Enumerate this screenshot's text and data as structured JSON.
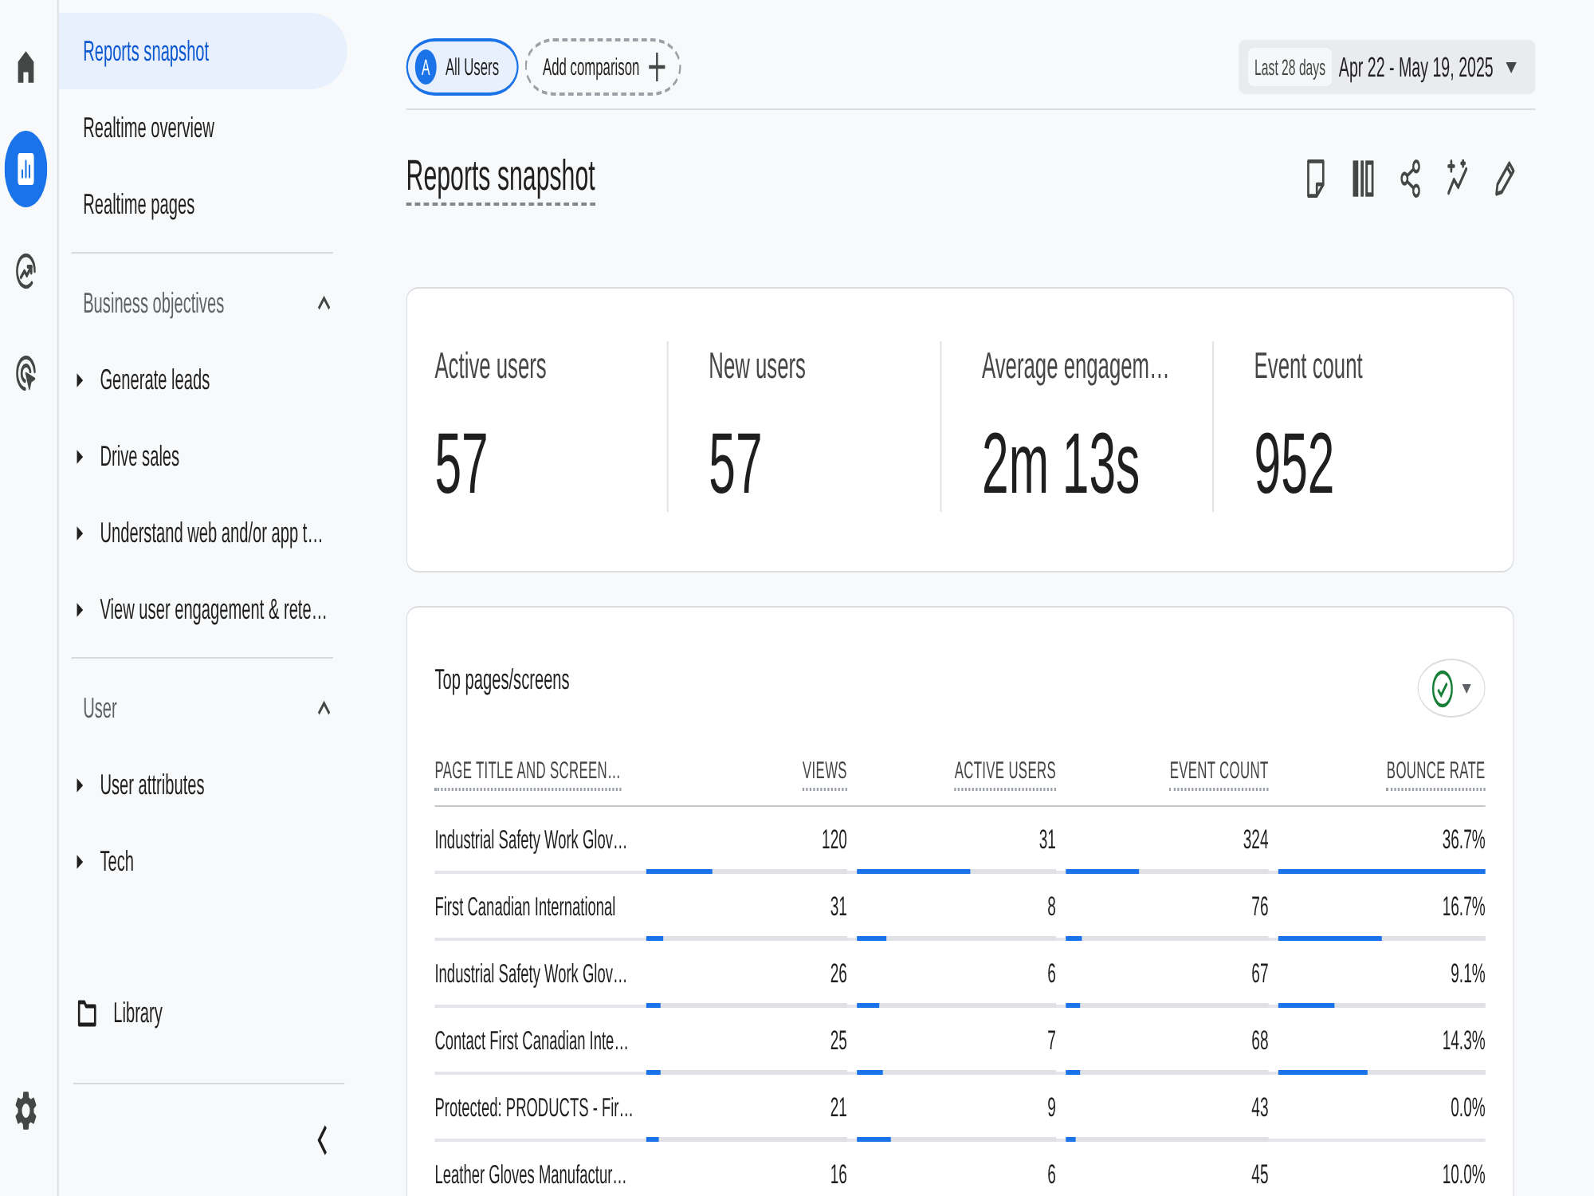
{
  "rail": {
    "items": [
      {
        "kind": "home",
        "selected": false
      },
      {
        "kind": "reports",
        "selected": true
      },
      {
        "kind": "explore",
        "selected": false
      },
      {
        "kind": "advertising",
        "selected": false
      }
    ]
  },
  "sidebar": {
    "items": [
      {
        "label": "Reports snapshot",
        "selected": true
      },
      {
        "label": "Realtime overview",
        "selected": false
      },
      {
        "label": "Realtime pages",
        "selected": false
      }
    ],
    "sections": [
      {
        "title": "Business objectives",
        "expanded": true,
        "items": [
          {
            "label": "Generate leads",
            "expanded": false
          },
          {
            "label": "Drive sales",
            "expanded": false
          },
          {
            "label": "Understand web and/or app t…",
            "expanded": false
          },
          {
            "label": "View user engagement & rete…",
            "expanded": false
          }
        ]
      },
      {
        "title": "User",
        "expanded": true,
        "items": [
          {
            "label": "User attributes",
            "expanded": false
          },
          {
            "label": "Tech",
            "expanded": false
          }
        ]
      }
    ],
    "library": "Library"
  },
  "comparison_bar": {
    "segments": [
      {
        "avatar": "A",
        "label": "All Users"
      }
    ],
    "add_comparison": "Add comparison"
  },
  "date_range": {
    "preset": "Last 28 days",
    "range": "Apr 22 - May 19, 2025"
  },
  "page_title": "Reports snapshot",
  "kpis": [
    {
      "label": "Active users",
      "value": "57"
    },
    {
      "label": "New users",
      "value": "57"
    },
    {
      "label": "Average engagem…",
      "value": "2m 13s"
    },
    {
      "label": "Event count",
      "value": "952"
    }
  ],
  "top_pages": {
    "title": "Top pages/screens",
    "columns": [
      "PAGE TITLE AND SCREEN…",
      "VIEWS",
      "ACTIVE USERS",
      "EVENT COUNT",
      "BOUNCE RATE"
    ],
    "rows": [
      {
        "page": "Industrial Safety Work Glov…",
        "metrics": [
          {
            "value": "120",
            "level": 0.33
          },
          {
            "value": "31",
            "level": 0.57
          },
          {
            "value": "324",
            "level": 0.36
          },
          {
            "value": "36.7%",
            "level": 1
          }
        ]
      },
      {
        "page": "First Canadian International",
        "metrics": [
          {
            "value": "31",
            "level": 0.085
          },
          {
            "value": "8",
            "level": 0.15
          },
          {
            "value": "76",
            "level": 0.08
          },
          {
            "value": "16.7%",
            "level": 0.5
          }
        ]
      },
      {
        "page": "Industrial Safety Work Glov…",
        "metrics": [
          {
            "value": "26",
            "level": 0.07
          },
          {
            "value": "6",
            "level": 0.11
          },
          {
            "value": "67",
            "level": 0.07
          },
          {
            "value": "9.1%",
            "level": 0.27
          }
        ]
      },
      {
        "page": "Contact First Canadian Inte…",
        "metrics": [
          {
            "value": "25",
            "level": 0.07
          },
          {
            "value": "7",
            "level": 0.13
          },
          {
            "value": "68",
            "level": 0.07
          },
          {
            "value": "14.3%",
            "level": 0.43
          }
        ]
      },
      {
        "page": "Protected: PRODUCTS - Fir…",
        "metrics": [
          {
            "value": "21",
            "level": 0.06
          },
          {
            "value": "9",
            "level": 0.17
          },
          {
            "value": "43",
            "level": 0.05
          },
          {
            "value": "0.0%"
          }
        ]
      },
      {
        "page": "Leather Gloves Manufactur…",
        "metrics": [
          {
            "value": "16"
          },
          {
            "value": "6"
          },
          {
            "value": "45"
          },
          {
            "value": "10.0%"
          }
        ]
      }
    ]
  }
}
